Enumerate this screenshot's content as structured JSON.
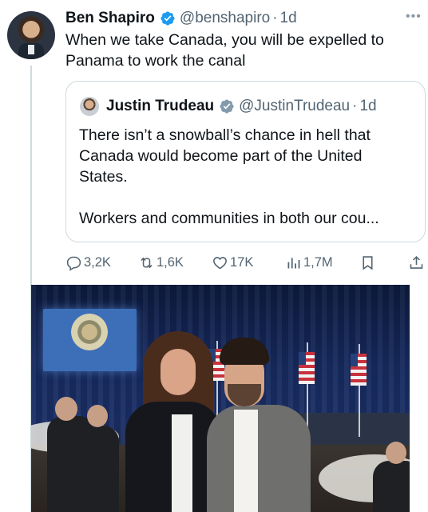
{
  "tweet": {
    "author_name": "Ben Shapiro",
    "author_handle": "@benshapiro",
    "separator": "·",
    "age": "1d",
    "more_label": "•••",
    "text": "When we take Canada, you will be expelled to Panama to work the canal"
  },
  "quoted_tweet": {
    "author_name": "Justin Trudeau",
    "author_handle": "@JustinTrudeau",
    "separator": "·",
    "age": "1d",
    "paragraph1": "There isn’t a snowball’s chance in hell that Canada would become part of the United States.",
    "paragraph2": "Workers and communities in both our cou..."
  },
  "actions": {
    "replies": "3,2K",
    "reposts": "1,6K",
    "likes": "17K",
    "views": "1,7M"
  },
  "colors": {
    "verified": "#1d9bf0",
    "secondary_text": "#536471",
    "border": "#cfd9de",
    "primary_text": "#0f1419"
  },
  "icons": {
    "reply": "reply-icon",
    "repost": "repost-icon",
    "like": "heart-icon",
    "views": "views-chart-icon",
    "bookmark": "bookmark-icon",
    "share": "share-icon",
    "verified": "verified-badge-icon",
    "more": "more-icon"
  }
}
